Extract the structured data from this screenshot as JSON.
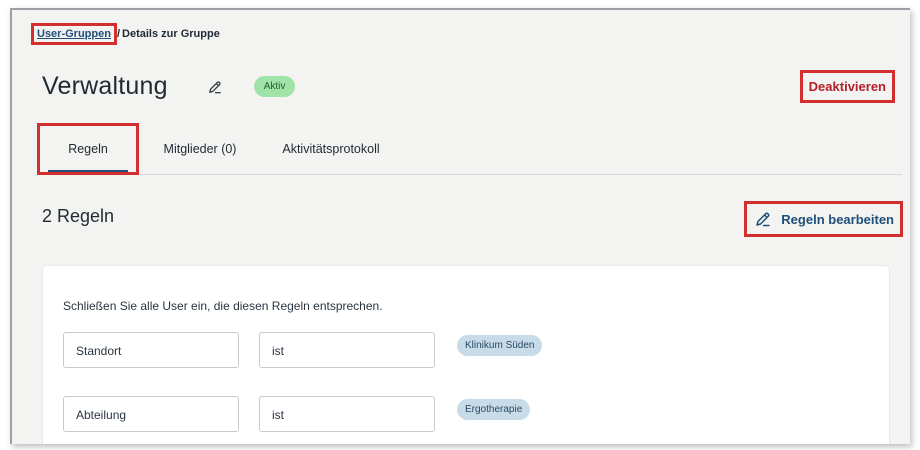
{
  "breadcrumb": {
    "parent": "User-Gruppen",
    "separator": "/",
    "current": "Details zur Gruppe"
  },
  "header": {
    "title": "Verwaltung",
    "status_badge": "Aktiv",
    "deactivate_label": "Deaktivieren"
  },
  "tabs": [
    {
      "label": "Regeln",
      "active": true
    },
    {
      "label": "Mitglieder (0)",
      "active": false
    },
    {
      "label": "Aktivitätsprotokoll",
      "active": false
    }
  ],
  "rules_section": {
    "count_title": "2 Regeln",
    "edit_label": "Regeln bearbeiten",
    "description": "Schließen Sie alle User ein, die diesen Regeln entsprechen.",
    "rules": [
      {
        "attribute": "Standort",
        "operator": "ist",
        "value": "Klinikum Süden"
      },
      {
        "attribute": "Abteilung",
        "operator": "ist",
        "value": "Ergotherapie"
      }
    ]
  },
  "colors": {
    "accent": "#1f4e79",
    "danger": "#b3202a",
    "highlight": "#d32f2f",
    "active_badge_bg": "#9fe3a8",
    "value_tag_bg": "#c7dbe8"
  },
  "icons": [
    "pencil-icon"
  ]
}
